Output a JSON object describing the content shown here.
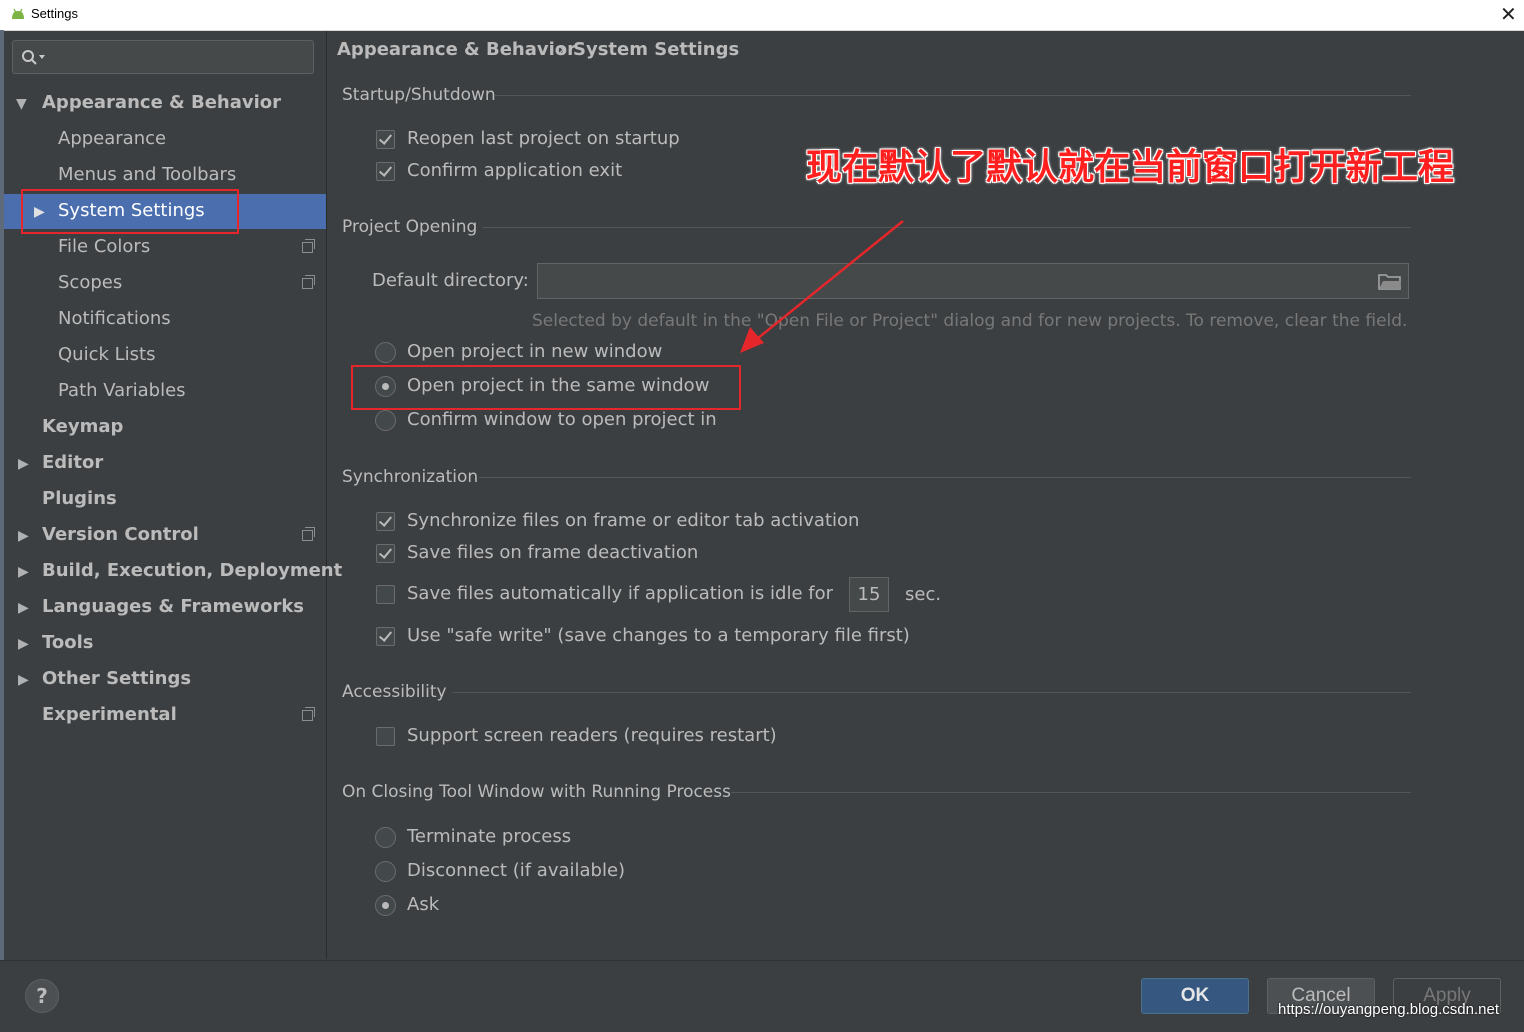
{
  "window": {
    "title": "Settings",
    "close_glyph": "✕"
  },
  "search": {
    "value": "",
    "icon": "search-icon"
  },
  "sidebar": {
    "items": [
      {
        "label": "Appearance & Behavior"
      },
      {
        "label": "Appearance"
      },
      {
        "label": "Menus and Toolbars"
      },
      {
        "label": "System Settings"
      },
      {
        "label": "File Colors"
      },
      {
        "label": "Scopes"
      },
      {
        "label": "Notifications"
      },
      {
        "label": "Quick Lists"
      },
      {
        "label": "Path Variables"
      },
      {
        "label": "Keymap"
      },
      {
        "label": "Editor"
      },
      {
        "label": "Plugins"
      },
      {
        "label": "Version Control"
      },
      {
        "label": "Build, Execution, Deployment"
      },
      {
        "label": "Languages & Frameworks"
      },
      {
        "label": "Tools"
      },
      {
        "label": "Other Settings"
      },
      {
        "label": "Experimental"
      }
    ],
    "selected": "System Settings",
    "selected_color": "#4b6eaf"
  },
  "breadcrumb": {
    "parent": "Appearance & Behavior",
    "separator": "›",
    "current": "System Settings"
  },
  "startup": {
    "title": "Startup/Shutdown",
    "reopen_label": "Reopen last project on startup",
    "reopen_checked": true,
    "confirm_exit_label": "Confirm application exit",
    "confirm_exit_checked": true
  },
  "project_opening": {
    "title": "Project Opening",
    "default_dir_label": "Default directory:",
    "default_dir_value": "",
    "hint": "Selected by default in the \"Open File or Project\" dialog and for new projects. To remove, clear the field.",
    "options": [
      "Open project in new window",
      "Open project in the same window",
      "Confirm window to open project in"
    ],
    "selected": "Open project in the same window"
  },
  "sync": {
    "title": "Synchronization",
    "sync_files_label": "Synchronize files on frame or editor tab activation",
    "sync_files_checked": true,
    "save_deactivation_label": "Save files on frame deactivation",
    "save_deactivation_checked": true,
    "save_idle_label": "Save files automatically if application is idle for",
    "save_idle_checked": false,
    "idle_seconds": "15",
    "idle_unit": "sec.",
    "safe_write_label": "Use \"safe write\" (save changes to a temporary file first)",
    "safe_write_checked": true
  },
  "accessibility": {
    "title": "Accessibility",
    "screen_readers_label": "Support screen readers (requires restart)",
    "screen_readers_checked": false
  },
  "closing": {
    "title": "On Closing Tool Window with Running Process",
    "options": [
      "Terminate process",
      "Disconnect (if available)",
      "Ask"
    ],
    "selected": "Ask"
  },
  "annotation": {
    "text": "现在默认了默认就在当前窗口打开新工程",
    "color": "#ff1f1f"
  },
  "buttons": {
    "help": "?",
    "ok": "OK",
    "cancel": "Cancel",
    "apply": "Apply"
  },
  "watermark": "https://ouyangpeng.blog.csdn.net"
}
